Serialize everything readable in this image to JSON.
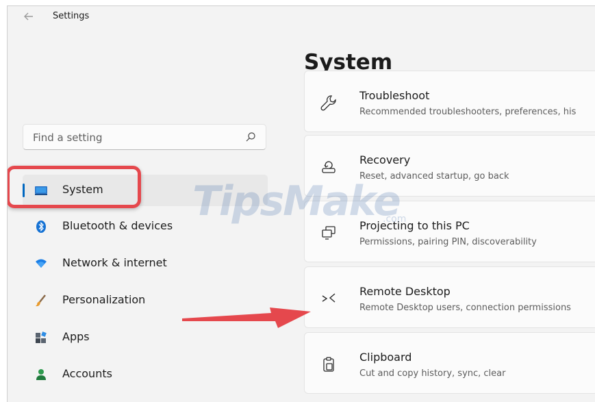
{
  "window": {
    "back_icon": "back-arrow-icon",
    "title": "Settings"
  },
  "page": {
    "title": "System"
  },
  "search": {
    "placeholder": "Find a setting",
    "icon": "search-icon"
  },
  "sidebar": {
    "selected": "System",
    "accent_color": "#0067c0",
    "items": [
      {
        "label": "System",
        "icon": "system-display-icon"
      },
      {
        "label": "Bluetooth & devices",
        "icon": "bluetooth-icon"
      },
      {
        "label": "Network & internet",
        "icon": "wifi-icon"
      },
      {
        "label": "Personalization",
        "icon": "paintbrush-icon"
      },
      {
        "label": "Apps",
        "icon": "apps-icon"
      },
      {
        "label": "Accounts",
        "icon": "person-icon"
      }
    ]
  },
  "settings": [
    {
      "title": "Troubleshoot",
      "description": "Recommended troubleshooters, preferences, his",
      "icon": "wrench-icon"
    },
    {
      "title": "Recovery",
      "description": "Reset, advanced startup, go back",
      "icon": "recovery-icon"
    },
    {
      "title": "Projecting to this PC",
      "description": "Permissions, pairing PIN, discoverability",
      "icon": "projecting-icon"
    },
    {
      "title": "Remote Desktop",
      "description": "Remote Desktop users, connection permissions",
      "icon": "remote-desktop-icon"
    },
    {
      "title": "Clipboard",
      "description": "Cut and copy history, sync, clear",
      "icon": "clipboard-icon"
    }
  ],
  "overlay": {
    "watermark": "TipsMake",
    "watermark_suffix": ".com",
    "highlight_color": "#e5484d",
    "arrow_color": "#e5484d"
  }
}
